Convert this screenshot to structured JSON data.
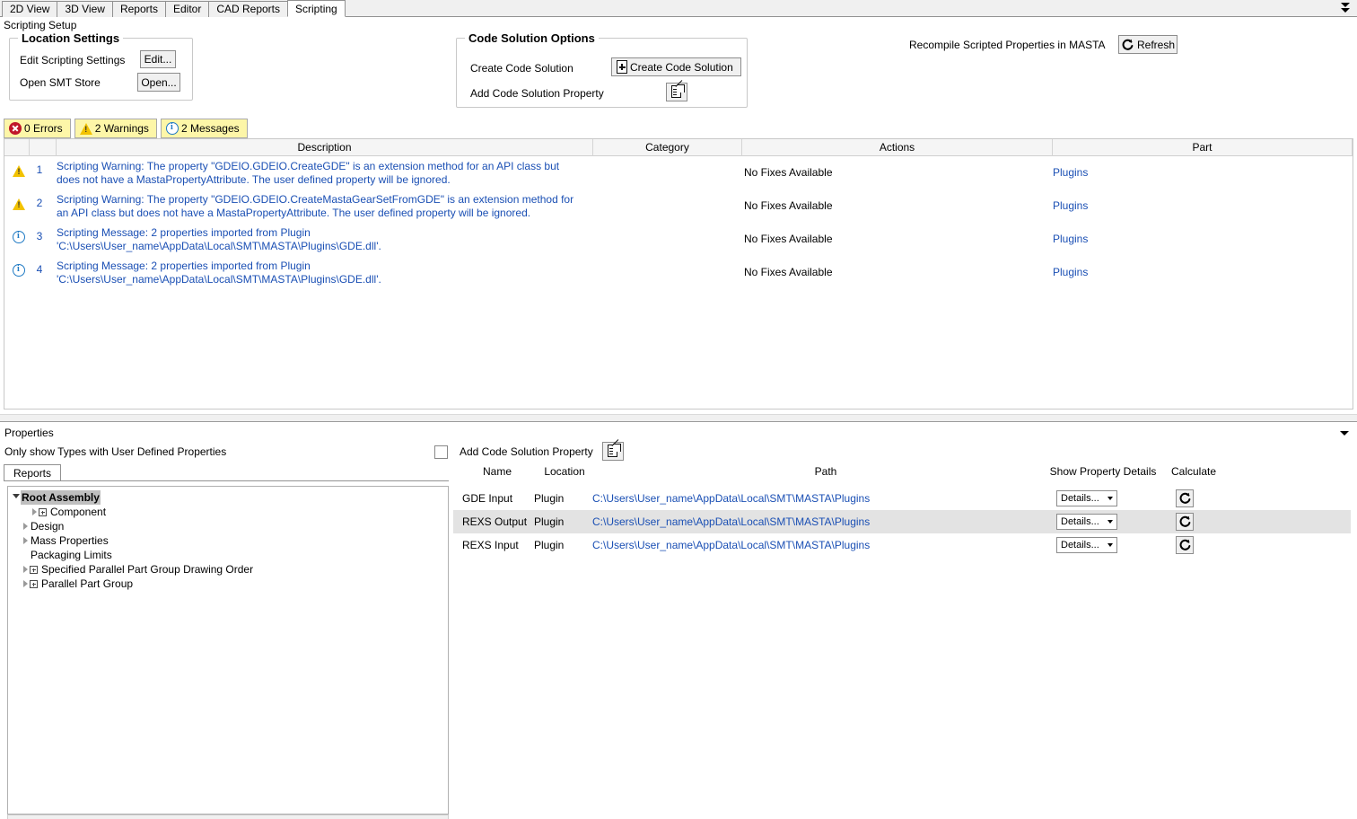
{
  "window": {
    "tabs": [
      {
        "label": "2D View",
        "active": false
      },
      {
        "label": "3D View",
        "active": false
      },
      {
        "label": "Reports",
        "active": false
      },
      {
        "label": "Editor",
        "active": false
      },
      {
        "label": "CAD Reports",
        "active": false
      },
      {
        "label": "Scripting",
        "active": true
      }
    ],
    "page_title": "Scripting Setup"
  },
  "location_settings": {
    "legend": "Location Settings",
    "rows": [
      {
        "label": "Edit Scripting Settings",
        "button": "Edit..."
      },
      {
        "label": "Open SMT Store",
        "button": "Open..."
      }
    ]
  },
  "code_solution_options": {
    "legend": "Code Solution Options",
    "create_label": "Create Code Solution",
    "create_button": "Create Code Solution",
    "add_property_label": "Add Code Solution Property"
  },
  "recompile": {
    "label": "Recompile Scripted Properties in MASTA",
    "button": "Refresh"
  },
  "severity_filters": [
    {
      "icon": "error-icon",
      "label": "0 Errors"
    },
    {
      "icon": "warning-icon",
      "label": "2 Warnings"
    },
    {
      "icon": "info-icon",
      "label": "2 Messages"
    }
  ],
  "messages_grid": {
    "columns": [
      "Description",
      "Category",
      "Actions",
      "Part"
    ],
    "rows": [
      {
        "severity": "warning",
        "number": "1",
        "description": "Scripting Warning: The property \"GDEIO.GDEIO.CreateGDE\" is an extension method for an API class but does not have a MastaPropertyAttribute. The user defined property will be ignored.",
        "category": "",
        "actions": "No Fixes Available",
        "part": "Plugins"
      },
      {
        "severity": "warning",
        "number": "2",
        "description": "Scripting Warning: The property \"GDEIO.GDEIO.CreateMastaGearSetFromGDE\" is an extension method for an API class but does not have a MastaPropertyAttribute. The user defined property will be ignored.",
        "category": "",
        "actions": "No Fixes Available",
        "part": "Plugins"
      },
      {
        "severity": "info",
        "number": "3",
        "description": "Scripting Message: 2 properties imported from Plugin 'C:\\Users\\User_name\\AppData\\Local\\SMT\\MASTA\\Plugins\\GDE.dll'.",
        "category": "",
        "actions": "No Fixes Available",
        "part": "Plugins"
      },
      {
        "severity": "info",
        "number": "4",
        "description": "Scripting Message: 2 properties imported from Plugin 'C:\\Users\\User_name\\AppData\\Local\\SMT\\MASTA\\Plugins\\GDE.dll'.",
        "category": "",
        "actions": "No Fixes Available",
        "part": "Plugins"
      }
    ]
  },
  "properties_panel": {
    "title": "Properties",
    "only_show_label": "Only show Types with User Defined Properties",
    "only_show_checked": false,
    "left_tab": "Reports",
    "tree": [
      {
        "label": "Root Assembly",
        "depth": 0,
        "arrow": "open",
        "box": false,
        "selected": true
      },
      {
        "label": "Component",
        "depth": 2,
        "arrow": "closed",
        "box": true,
        "selected": false
      },
      {
        "label": "Design",
        "depth": 1,
        "arrow": "closed",
        "box": false,
        "selected": false
      },
      {
        "label": "Mass Properties",
        "depth": 1,
        "arrow": "closed",
        "box": false,
        "selected": false
      },
      {
        "label": "Packaging Limits",
        "depth": 1,
        "arrow": "none",
        "box": false,
        "selected": false
      },
      {
        "label": "Specified Parallel Part Group Drawing Order",
        "depth": 1,
        "arrow": "closed",
        "box": true,
        "selected": false
      },
      {
        "label": "Parallel Part Group",
        "depth": 1,
        "arrow": "closed",
        "box": true,
        "selected": false
      }
    ],
    "add_property_label": "Add Code Solution Property",
    "grid": {
      "columns": [
        "Name",
        "Location",
        "Path",
        "Show Property Details",
        "Calculate"
      ],
      "rows": [
        {
          "name": "GDE Input",
          "location": "Plugin",
          "path": "C:\\Users\\User_name\\AppData\\Local\\SMT\\MASTA\\Plugins",
          "details": "Details...",
          "selected": false
        },
        {
          "name": "REXS Output",
          "location": "Plugin",
          "path": "C:\\Users\\User_name\\AppData\\Local\\SMT\\MASTA\\Plugins",
          "details": "Details...",
          "selected": true
        },
        {
          "name": "REXS Input",
          "location": "Plugin",
          "path": "C:\\Users\\User_name\\AppData\\Local\\SMT\\MASTA\\Plugins",
          "details": "Details...",
          "selected": false
        }
      ]
    }
  },
  "colors": {
    "link": "#1a4fb4",
    "severity_button_bg": "#fdf6a8",
    "selection": "#bfbfbf",
    "row_selection": "#e3e3e3"
  }
}
